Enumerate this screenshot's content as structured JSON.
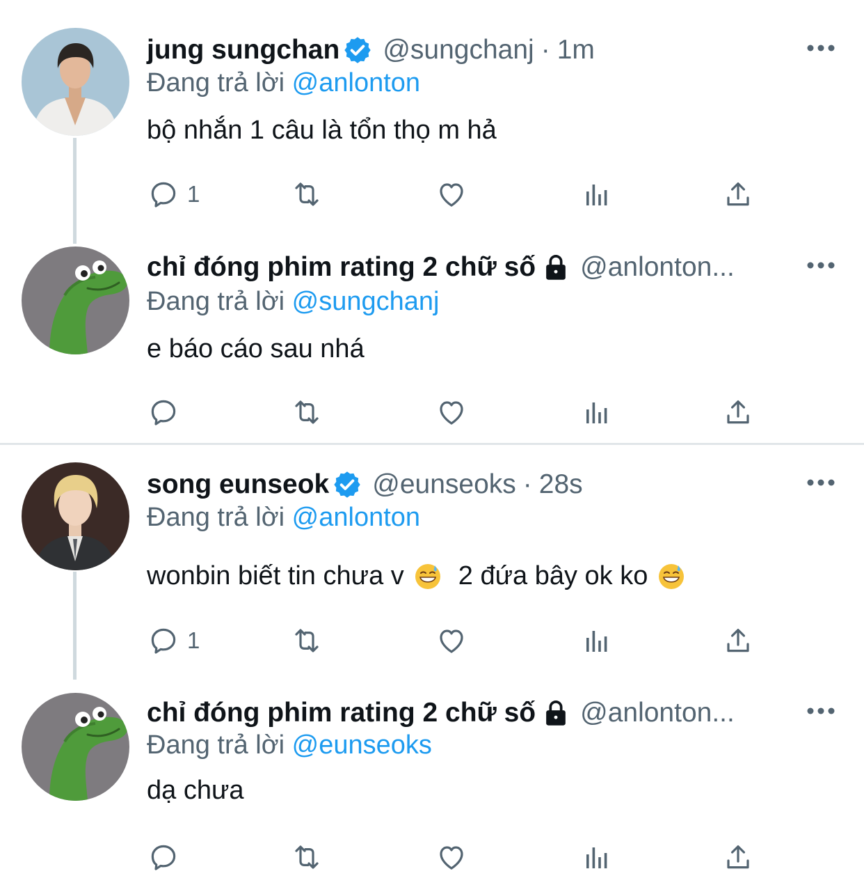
{
  "colors": {
    "accent": "#1d9bf0",
    "text": "#0f1419",
    "muted": "#536471",
    "thread_line": "#cfd9de",
    "divider": "#e1e6e9"
  },
  "threads": [
    {
      "tweets": [
        {
          "name": "jung sungchan",
          "verified": true,
          "handle": "@sungchanj",
          "sep": "·",
          "time": "1m",
          "replying_prefix": "Đang trả lời",
          "replying_to": "@anlonton",
          "text": "bộ nhắn 1 câu là tổn thọ m hả",
          "reply_count": "1",
          "avatar": "person-white-jacket"
        },
        {
          "name": "chỉ đóng phim rating 2 chữ số",
          "locked": true,
          "handle": "@anlonton...",
          "replying_prefix": "Đang trả lời",
          "replying_to": "@sungchanj",
          "text": "e báo cáo sau nhá",
          "reply_count": "",
          "avatar": "green-dinosaur"
        }
      ]
    },
    {
      "tweets": [
        {
          "name": "song eunseok",
          "verified": true,
          "handle": "@eunseoks",
          "sep": "·",
          "time": "28s",
          "replying_prefix": "Đang trả lời",
          "replying_to": "@anlonton",
          "text_part1": "wonbin biết tin chưa v",
          "text_part2": "2 đứa bây ok ko",
          "emoji": "grinning-sweat-emoji",
          "reply_count": "1",
          "avatar": "person-blond-hair"
        },
        {
          "name": "chỉ đóng phim rating 2 chữ số",
          "locked": true,
          "handle": "@anlonton...",
          "replying_prefix": "Đang trả lời",
          "replying_to": "@eunseoks",
          "text": "dạ chưa",
          "reply_count": "",
          "avatar": "green-dinosaur"
        }
      ]
    }
  ],
  "icons": [
    "verified-badge-icon",
    "lock-icon",
    "more-icon",
    "reply-icon",
    "retweet-icon",
    "like-icon",
    "views-icon",
    "share-icon"
  ]
}
